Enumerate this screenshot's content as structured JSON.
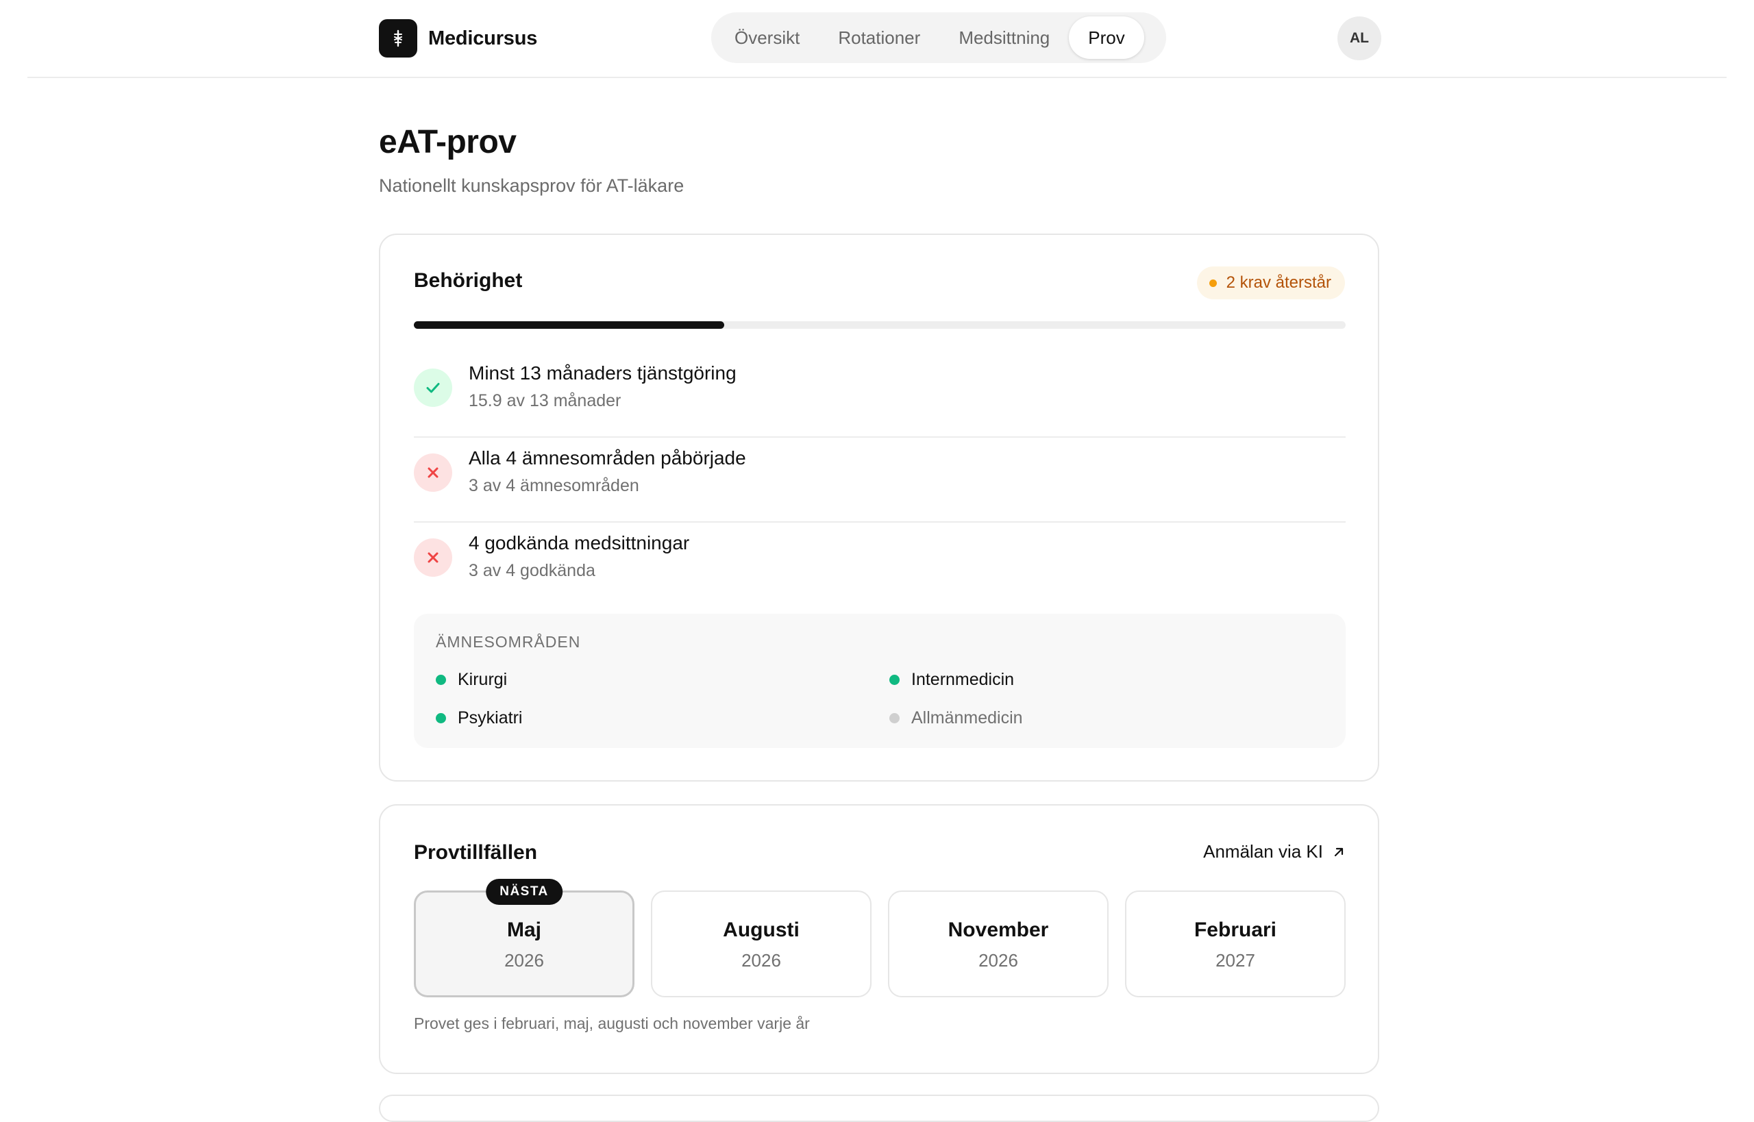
{
  "app": {
    "name": "Medicursus",
    "logo_icon": "caduceus-icon"
  },
  "nav": {
    "tabs": [
      {
        "label": "Översikt",
        "active": false
      },
      {
        "label": "Rotationer",
        "active": false
      },
      {
        "label": "Medsittning",
        "active": false
      },
      {
        "label": "Prov",
        "active": true
      }
    ]
  },
  "user": {
    "initials": "AL"
  },
  "page": {
    "title": "eAT-prov",
    "subtitle": "Nationellt kunskapsprov för AT-läkare"
  },
  "eligibility": {
    "title": "Behörighet",
    "status": "2 krav återstår",
    "progress_fraction": 0.333,
    "requirements": [
      {
        "title": "Minst 13 månaders tjänstgöring",
        "detail": "15.9 av 13 månader",
        "met": true
      },
      {
        "title": "Alla 4 ämnesområden påbörjade",
        "detail": "3 av 4 ämnesområden",
        "met": false
      },
      {
        "title": "4 godkända medsittningar",
        "detail": "3 av 4 godkända",
        "met": false
      }
    ],
    "areas_label": "ÄMNESOMRÅDEN",
    "areas": [
      {
        "name": "Kirurgi",
        "started": true
      },
      {
        "name": "Internmedicin",
        "started": true
      },
      {
        "name": "Psykiatri",
        "started": true
      },
      {
        "name": "Allmänmedicin",
        "started": false
      }
    ]
  },
  "sessions": {
    "title": "Provtillfällen",
    "register_link": "Anmälan via KI",
    "next_badge": "NÄSTA",
    "items": [
      {
        "month": "Maj",
        "year": "2026",
        "selected": true
      },
      {
        "month": "Augusti",
        "year": "2026",
        "selected": false
      },
      {
        "month": "November",
        "year": "2026",
        "selected": false
      },
      {
        "month": "Februari",
        "year": "2027",
        "selected": false
      }
    ],
    "note": "Provet ges i februari, maj, augusti och november varje år"
  },
  "colors": {
    "accent": "#111111",
    "success": "#10b981",
    "danger": "#ef4444",
    "warning": "#f59e0b",
    "muted_dot": "#cfcfcf"
  }
}
